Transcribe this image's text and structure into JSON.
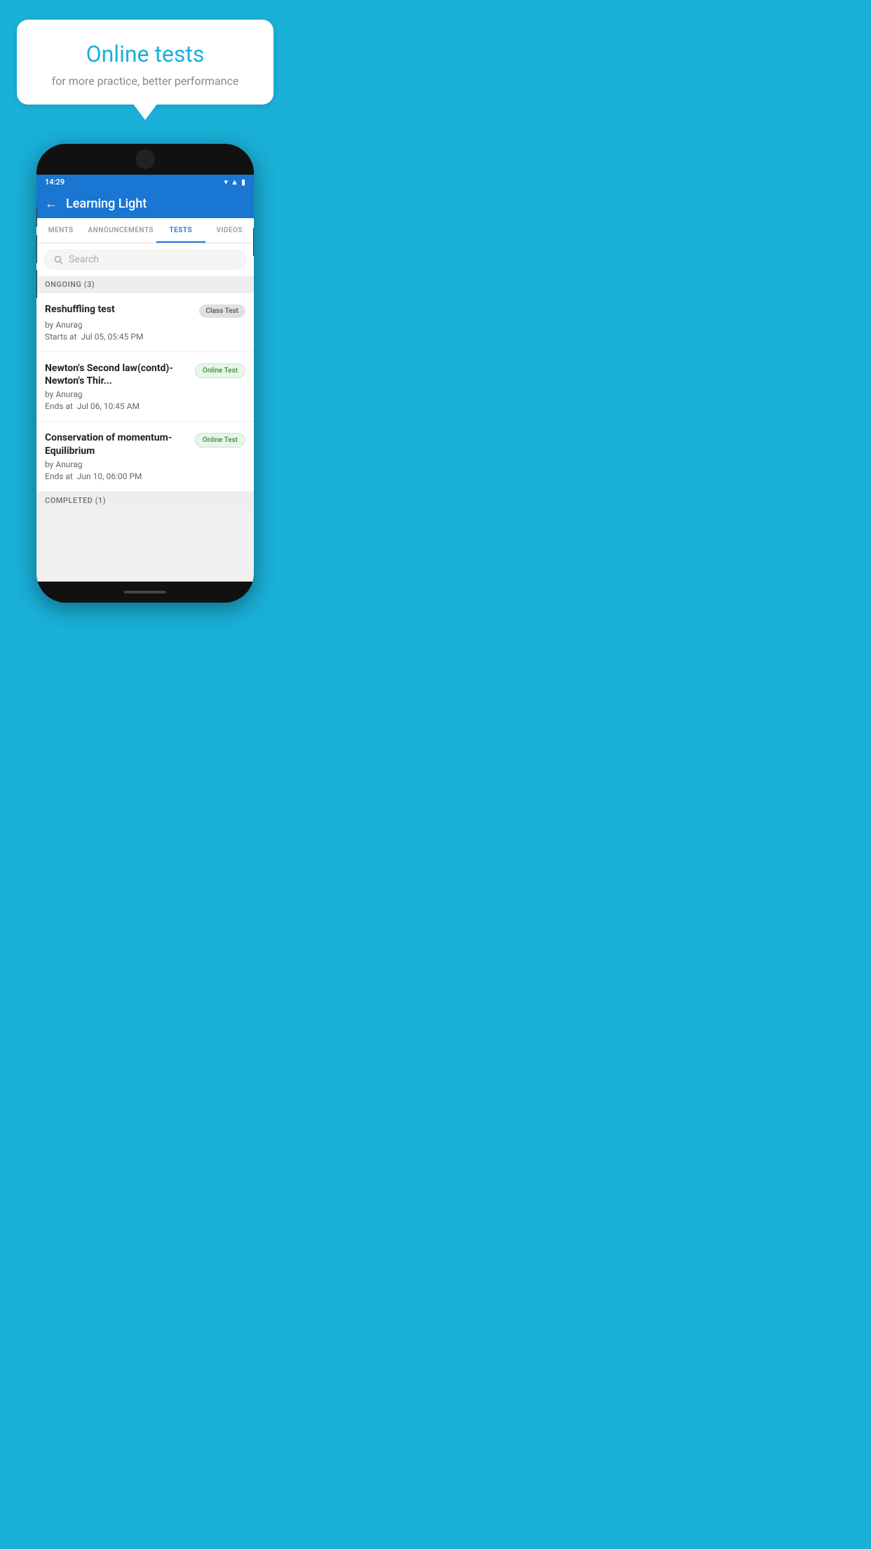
{
  "background_color": "#1ab0d8",
  "speech_bubble": {
    "title": "Online tests",
    "subtitle": "for more practice, better performance"
  },
  "phone": {
    "status_bar": {
      "time": "14:29",
      "icons": [
        "wifi",
        "signal",
        "battery"
      ]
    },
    "app_bar": {
      "title": "Learning Light",
      "back_label": "←"
    },
    "tabs": [
      {
        "label": "MENTS",
        "active": false
      },
      {
        "label": "ANNOUNCEMENTS",
        "active": false
      },
      {
        "label": "TESTS",
        "active": true
      },
      {
        "label": "VIDEOS",
        "active": false
      }
    ],
    "search": {
      "placeholder": "Search"
    },
    "ongoing_section": {
      "label": "ONGOING (3)"
    },
    "tests": [
      {
        "title": "Reshuffling test",
        "badge": "Class Test",
        "badge_type": "class",
        "by": "by Anurag",
        "date_label": "Starts at",
        "date": "Jul 05, 05:45 PM"
      },
      {
        "title": "Newton's Second law(contd)-Newton's Thir...",
        "badge": "Online Test",
        "badge_type": "online",
        "by": "by Anurag",
        "date_label": "Ends at",
        "date": "Jul 06, 10:45 AM"
      },
      {
        "title": "Conservation of momentum-Equilibrium",
        "badge": "Online Test",
        "badge_type": "online",
        "by": "by Anurag",
        "date_label": "Ends at",
        "date": "Jun 10, 06:00 PM"
      }
    ],
    "completed_section": {
      "label": "COMPLETED (1)"
    }
  }
}
